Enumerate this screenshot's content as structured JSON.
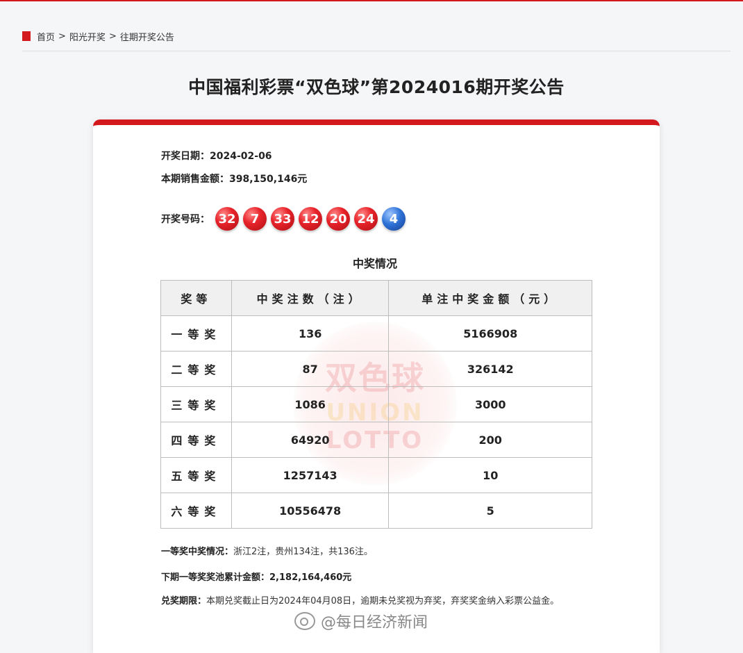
{
  "breadcrumb": {
    "home": "首页",
    "sep": ">",
    "sunshine": "阳光开奖",
    "history": "往期开奖公告"
  },
  "page_title": "中国福利彩票“双色球”第2024016期开奖公告",
  "draw": {
    "date_label": "开奖日期：",
    "date_value": "2024-02-06",
    "sales_label": "本期销售金额：",
    "sales_value": "398,150,146元",
    "numbers_label": "开奖号码：",
    "red_balls": [
      "32",
      "7",
      "33",
      "12",
      "20",
      "24"
    ],
    "blue_ball": "4"
  },
  "section_title": "中奖情况",
  "table": {
    "headers": [
      "奖等",
      "中奖注数（注）",
      "单注中奖金额（元）"
    ],
    "rows": [
      {
        "level": "一等奖",
        "count": "136",
        "amount": "5166908"
      },
      {
        "level": "二等奖",
        "count": "87",
        "amount": "326142"
      },
      {
        "level": "三等奖",
        "count": "1086",
        "amount": "3000"
      },
      {
        "level": "四等奖",
        "count": "64920",
        "amount": "200"
      },
      {
        "level": "五等奖",
        "count": "1257143",
        "amount": "10"
      },
      {
        "level": "六等奖",
        "count": "10556478",
        "amount": "5"
      }
    ]
  },
  "watermark": {
    "cn": "双色球",
    "en1": "UNION",
    "en2": "LOTTO"
  },
  "notes": {
    "first_prize_label": "一等奖中奖情况：",
    "first_prize_text": "浙江2注，贵州134注，共136注。",
    "pool_label": "下期一等奖奖池累计金额：",
    "pool_value": "2,182,164,460元",
    "claim_label": "兑奖期限：",
    "claim_text": "本期兑奖截止日为2024年04月08日，逾期未兑奖视为弃奖，弃奖奖金纳入彩票公益金。"
  },
  "footer": {
    "source": "@每日经济新闻"
  },
  "colors": {
    "accent": "#d4191e",
    "blue_ball": "#2f73d8"
  }
}
